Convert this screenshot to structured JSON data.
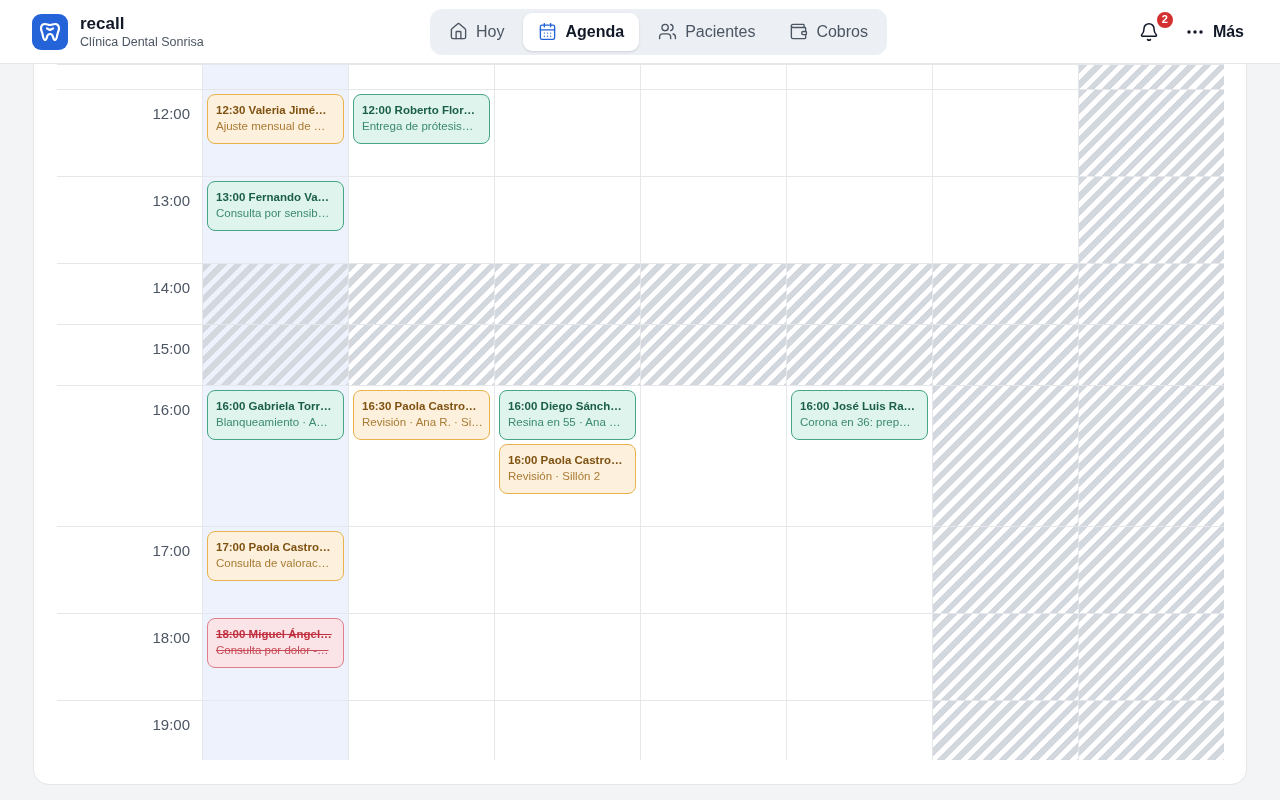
{
  "header": {
    "brand": {
      "name": "recall",
      "subtitle": "Clínica Dental Sonrisa"
    },
    "tabs": [
      {
        "label": "Hoy",
        "kind": "home",
        "selected": false
      },
      {
        "label": "Agenda",
        "kind": "calendar",
        "selected": true
      },
      {
        "label": "Pacientes",
        "kind": "users",
        "selected": false
      },
      {
        "label": "Cobros",
        "kind": "wallet",
        "selected": false
      }
    ],
    "notifications": {
      "count": "2"
    },
    "more": {
      "label": "Más"
    }
  },
  "days": [
    {
      "today": true
    },
    {
      "today": false
    },
    {
      "today": false
    },
    {
      "today": false
    },
    {
      "today": false
    },
    {
      "today": false
    },
    {
      "today": false
    }
  ],
  "rows": [
    {
      "cells": [
        {
          "closed": false
        },
        {
          "closed": false
        },
        {
          "closed": false
        },
        {
          "closed": false
        },
        {
          "closed": false
        },
        {
          "closed": false
        },
        {
          "closed": true
        }
      ]
    },
    {
      "time": "12:00",
      "cells": [
        {
          "closed": false,
          "appointments": [
            {
              "title": "12:30 Valeria Jimé…",
              "detail": "Ajuste mensual de …",
              "kind": "pending"
            }
          ]
        },
        {
          "closed": false,
          "appointments": [
            {
              "title": "12:00 Roberto Flor…",
              "detail": "Entrega de prótesis…",
              "kind": "confirmed"
            }
          ]
        },
        {
          "closed": false
        },
        {
          "closed": false
        },
        {
          "closed": false
        },
        {
          "closed": false
        },
        {
          "closed": true
        }
      ]
    },
    {
      "time": "13:00",
      "cells": [
        {
          "closed": false,
          "appointments": [
            {
              "title": "13:00 Fernando Va…",
              "detail": "Consulta por sensib…",
              "kind": "confirmed"
            }
          ]
        },
        {
          "closed": false
        },
        {
          "closed": false
        },
        {
          "closed": false
        },
        {
          "closed": false
        },
        {
          "closed": false
        },
        {
          "closed": true
        }
      ]
    },
    {
      "time": "14:00",
      "cells": [
        {
          "closed": true
        },
        {
          "closed": true
        },
        {
          "closed": true
        },
        {
          "closed": true
        },
        {
          "closed": true
        },
        {
          "closed": true
        },
        {
          "closed": true
        }
      ]
    },
    {
      "time": "15:00",
      "cells": [
        {
          "closed": true
        },
        {
          "closed": true
        },
        {
          "closed": true
        },
        {
          "closed": true
        },
        {
          "closed": true
        },
        {
          "closed": true
        },
        {
          "closed": true
        }
      ]
    },
    {
      "time": "16:00",
      "cells": [
        {
          "closed": false,
          "appointments": [
            {
              "title": "16:00 Gabriela Torr…",
              "detail": "Blanqueamiento · A…",
              "kind": "confirmed"
            }
          ]
        },
        {
          "closed": false,
          "appointments": [
            {
              "title": "16:30 Paola Castro…",
              "detail": "Revisión · Ana R. · Si…",
              "kind": "pending"
            }
          ]
        },
        {
          "closed": false,
          "appointments": [
            {
              "title": "16:00 Diego Sánch…",
              "detail": "Resina en 55 · Ana …",
              "kind": "confirmed"
            },
            {
              "title": "16:00 Paola Castro…",
              "detail": "Revisión · Sillón 2",
              "kind": "pending"
            }
          ]
        },
        {
          "closed": false
        },
        {
          "closed": false,
          "appointments": [
            {
              "title": "16:00 José Luis Ra…",
              "detail": "Corona en 36: prep…",
              "kind": "confirmed"
            }
          ]
        },
        {
          "closed": true
        },
        {
          "closed": true
        }
      ]
    },
    {
      "time": "17:00",
      "cells": [
        {
          "closed": false,
          "appointments": [
            {
              "title": "17:00 Paola Castro…",
              "detail": "Consulta de valorac…",
              "kind": "pending"
            }
          ]
        },
        {
          "closed": false
        },
        {
          "closed": false
        },
        {
          "closed": false
        },
        {
          "closed": false
        },
        {
          "closed": true
        },
        {
          "closed": true
        }
      ]
    },
    {
      "time": "18:00",
      "cells": [
        {
          "closed": false,
          "appointments": [
            {
              "title": "18:00 Miguel Ángel…",
              "detail": "Consulta por dolor -…",
              "kind": "cancelled"
            }
          ]
        },
        {
          "closed": false
        },
        {
          "closed": false
        },
        {
          "closed": false
        },
        {
          "closed": false
        },
        {
          "closed": true
        },
        {
          "closed": true
        }
      ]
    },
    {
      "time": "19:00",
      "cells": [
        {
          "closed": false
        },
        {
          "closed": false
        },
        {
          "closed": false
        },
        {
          "closed": false
        },
        {
          "closed": false
        },
        {
          "closed": true
        },
        {
          "closed": true
        }
      ]
    }
  ]
}
